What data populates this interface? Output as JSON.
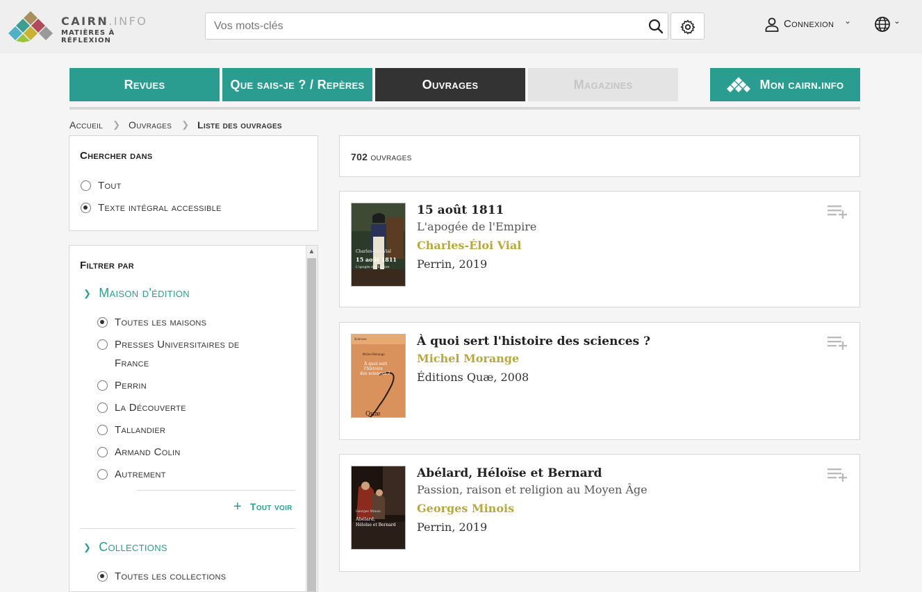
{
  "brand": {
    "name_main": "CAIRN",
    "name_dot": ".INFO",
    "tagline": "MATIÈRES À RÉFLEXION",
    "colors": [
      "#a88f5d",
      "#3c9d91",
      "#b04a5a",
      "#9cc33d",
      "#c9b234",
      "#4fb0c6",
      "#999999"
    ]
  },
  "header": {
    "search_placeholder": "Vos mots-clés",
    "search_icon": "search-icon",
    "settings_icon": "gear-icon",
    "login_label": "Connexion",
    "language_icon": "globe-icon"
  },
  "tabs": [
    {
      "label": "Revues",
      "state": "normal"
    },
    {
      "label": "Que sais-je ? / Repères",
      "state": "normal"
    },
    {
      "label": "Ouvrages",
      "state": "active"
    },
    {
      "label": "Magazines",
      "state": "disabled"
    },
    {
      "label": "Mon cairn.info",
      "state": "normal"
    }
  ],
  "breadcrumb": [
    "Accueil",
    "Ouvrages",
    "Liste des ouvrages"
  ],
  "search_in": {
    "title": "Chercher dans",
    "options": [
      {
        "label": "Tout",
        "selected": false
      },
      {
        "label": "Texte intégral accessible",
        "selected": true
      }
    ]
  },
  "filters": {
    "title": "Filtrer par",
    "publisher": {
      "title": "Maison d'édition",
      "options": [
        {
          "label": "Toutes les maisons",
          "selected": true
        },
        {
          "label": "Presses Universitaires de",
          "label2": "France",
          "selected": false
        },
        {
          "label": "Perrin",
          "selected": false
        },
        {
          "label": "La Découverte",
          "selected": false
        },
        {
          "label": "Tallandier",
          "selected": false
        },
        {
          "label": "Armand Colin",
          "selected": false
        },
        {
          "label": "Autrement",
          "selected": false
        }
      ],
      "see_all": "Tout voir"
    },
    "collections": {
      "title": "Collections",
      "options": [
        {
          "label": "Toutes les collections",
          "selected": true
        }
      ]
    }
  },
  "results": {
    "count": "702",
    "count_label": "ouvrages",
    "books": [
      {
        "title": "15 août 1811",
        "subtitle": "L'apogée de l'Empire",
        "author": "Charles-Éloi Vial",
        "publisher": "Perrin, 2019",
        "cover_text": [
          "Charles-Éloi Vial",
          "15 août 1811",
          "L'apogée de l'Empire"
        ]
      },
      {
        "title": "À quoi sert l'histoire des sciences ?",
        "subtitle": "",
        "author": "Michel Morange",
        "publisher": "Éditions Quæ, 2008",
        "cover_text": [
          "Michel Morange",
          "À quoi sert",
          "l'histoire",
          "des sciences ?",
          "Quæ"
        ]
      },
      {
        "title": "Abélard, Héloïse et Bernard",
        "subtitle": "Passion, raison et religion au Moyen Âge",
        "author": "Georges Minois",
        "publisher": "Perrin, 2019",
        "cover_text": [
          "Georges Minois",
          "Abélard,",
          "Héloïse et Bernard"
        ]
      }
    ]
  }
}
